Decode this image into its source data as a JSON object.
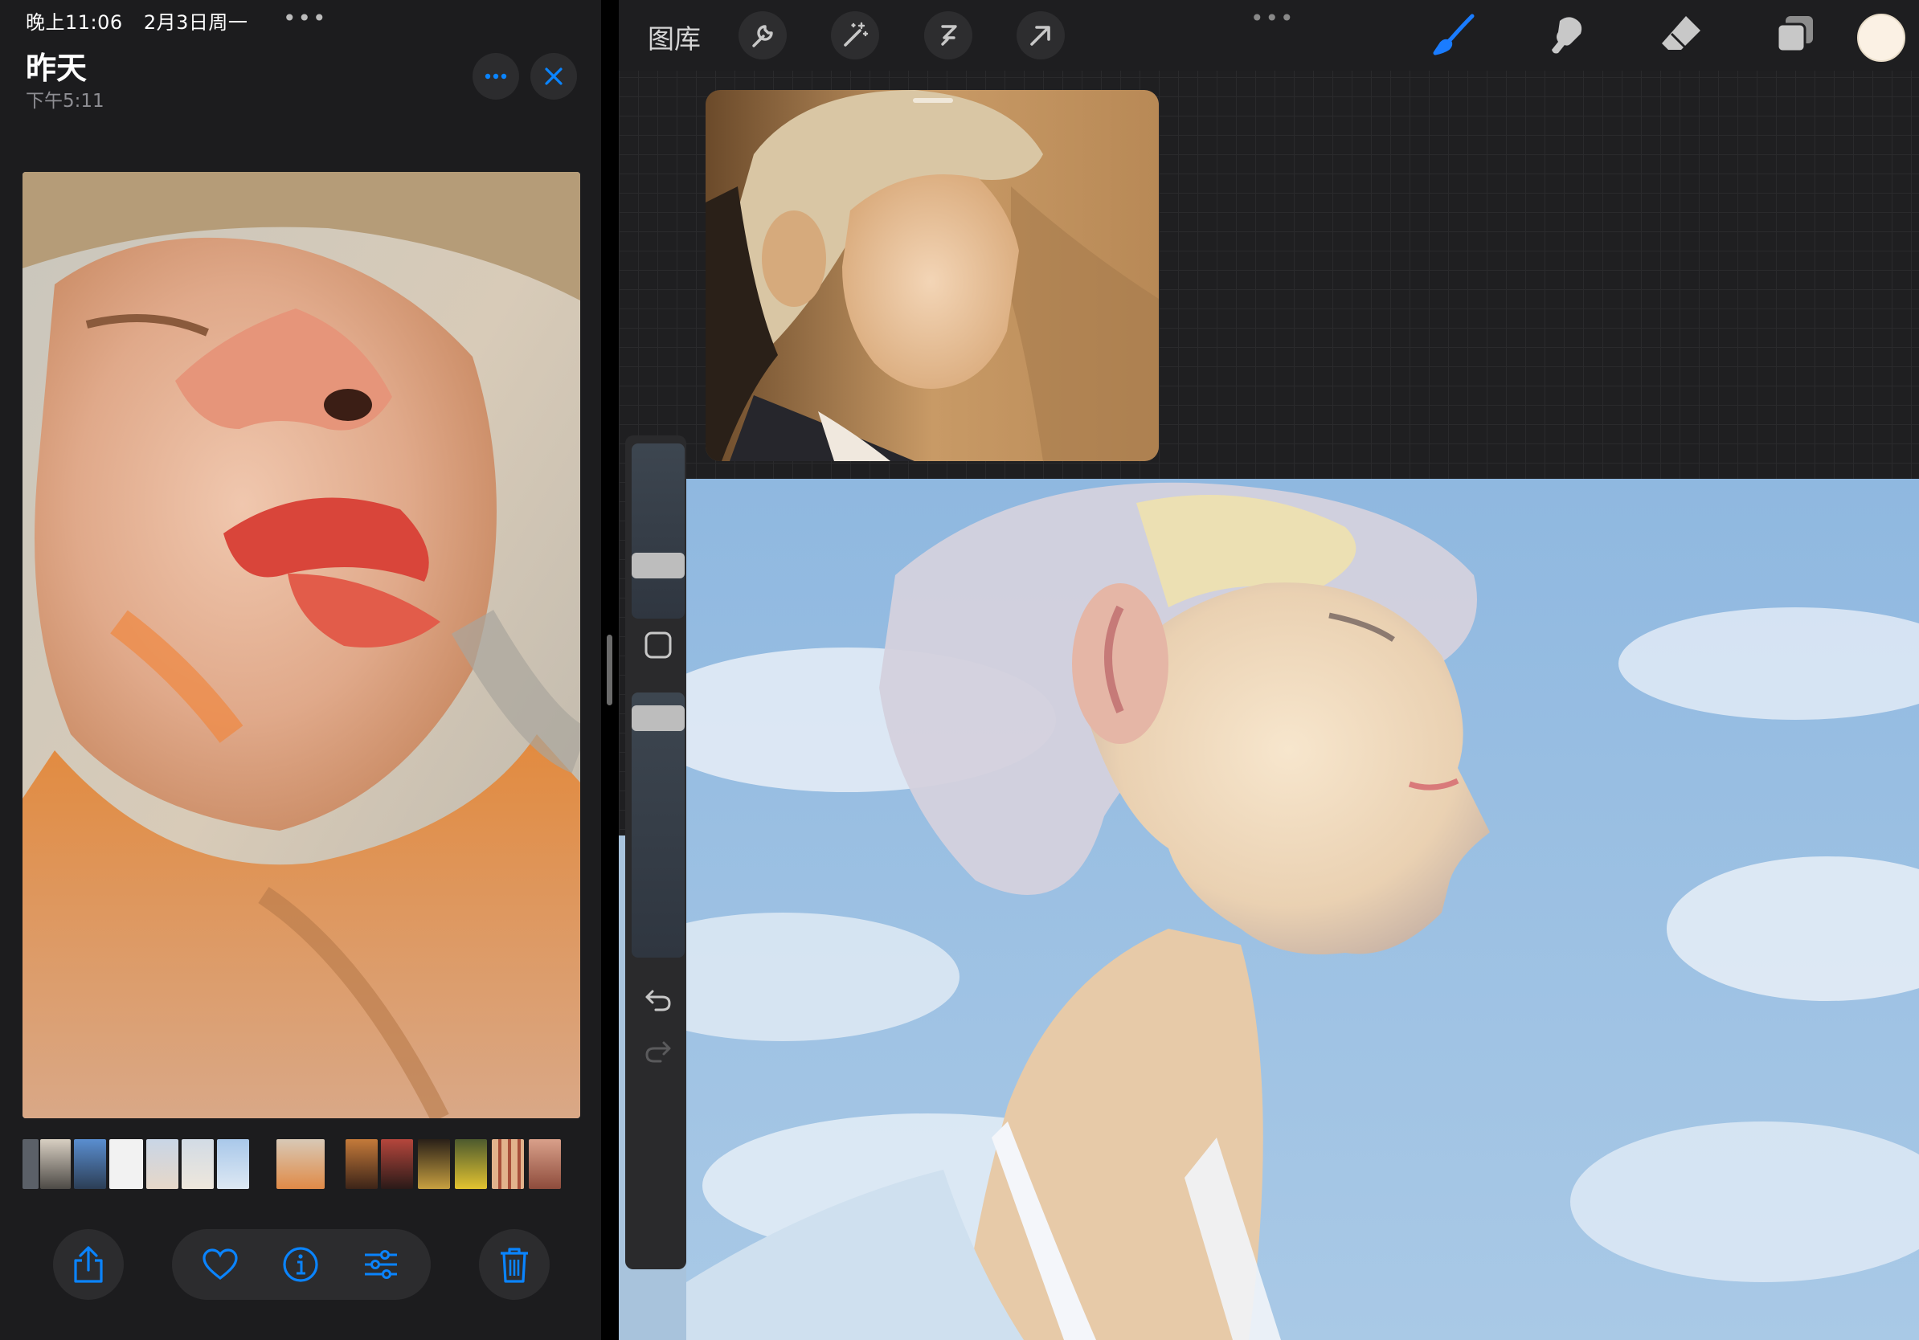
{
  "status_bar": {
    "time": "晚上11:06",
    "date": "2月3日周一",
    "more": "•••"
  },
  "photos": {
    "title": "昨天",
    "subtitle": "下午5:11",
    "buttons": {
      "more_icon": "ellipsis-icon",
      "close_icon": "close-icon"
    },
    "thumbnail_count": 14,
    "toolbar_icons": [
      "share-icon",
      "heart-icon",
      "info-icon",
      "adjust-icon",
      "trash-icon"
    ]
  },
  "procreate": {
    "gallery_label": "图库",
    "more": "•••",
    "tools_left": [
      "wrench-icon",
      "magic-wand-icon",
      "selection-icon",
      "transform-arrow-icon"
    ],
    "tools_right": [
      "brush-icon",
      "smudge-icon",
      "eraser-icon",
      "layers-icon"
    ],
    "current_color": "#fbf1e4",
    "accent_color": "#1a7cff",
    "sidebar": {
      "undo_icon": "undo-icon",
      "redo_icon": "redo-icon",
      "modify_icon": "square-modify-icon"
    }
  }
}
